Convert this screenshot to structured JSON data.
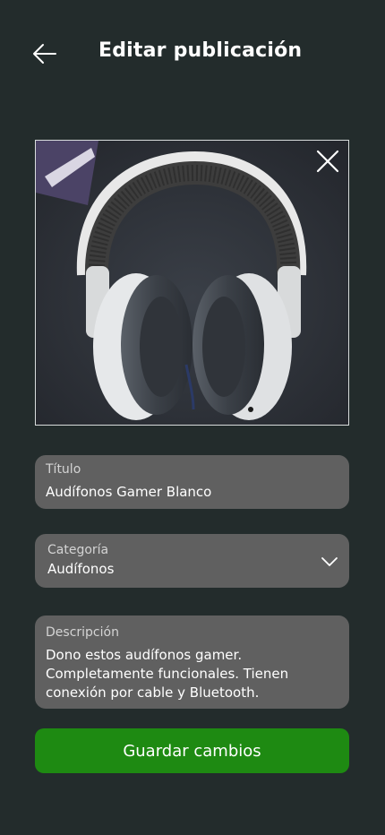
{
  "header": {
    "title": "Editar publicación",
    "back_icon": "arrow-left-icon"
  },
  "photo": {
    "close_icon": "close-icon",
    "alt": "headphones-photo"
  },
  "form": {
    "title": {
      "label": "Título",
      "value": "Audífonos Gamer Blanco"
    },
    "category": {
      "label": "Categoría",
      "value": "Audífonos",
      "icon": "chevron-down-icon"
    },
    "description": {
      "label": "Descripción",
      "value": "Dono estos audífonos gamer. Completamente funcionales. Tienen conexión por cable y Bluetooth."
    }
  },
  "actions": {
    "save_label": "Guardar cambios"
  },
  "colors": {
    "background": "#232c2c",
    "field": "#606060",
    "primary": "#1e8a12"
  }
}
